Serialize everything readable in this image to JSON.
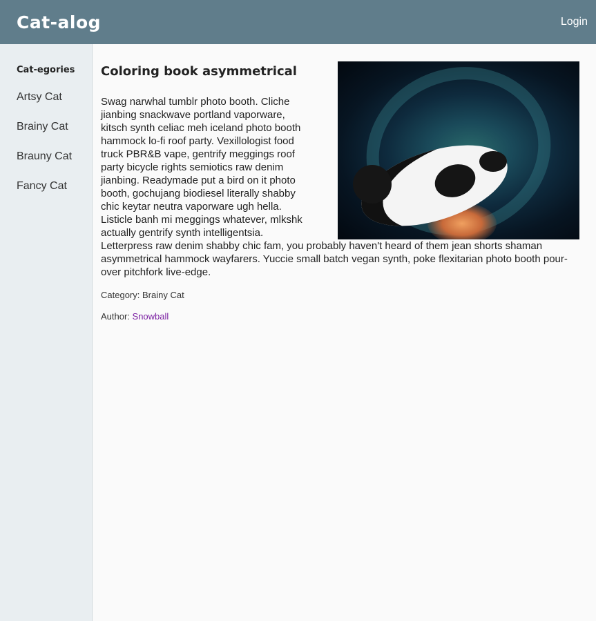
{
  "header": {
    "brand": "Cat-alog",
    "login_label": "Login"
  },
  "sidebar": {
    "title": "Cat-egories",
    "items": [
      {
        "label": "Artsy Cat"
      },
      {
        "label": "Brainy Cat"
      },
      {
        "label": "Brauny Cat"
      },
      {
        "label": "Fancy Cat"
      }
    ]
  },
  "post": {
    "title": "Coloring book asymmetrical",
    "body": "Swag narwhal tumblr photo booth. Cliche jianbing snackwave portland vaporware, kitsch synth celiac meh iceland photo booth hammock lo-fi roof party. Vexillologist food truck PBR&B vape, gentrify meggings roof party bicycle rights semiotics raw denim jianbing. Readymade put a bird on it photo booth, gochujang biodiesel literally shabby chic keytar neutra vaporware ugh hella. Listicle banh mi meggings whatever, mlkshk actually gentrify synth intelligentsia. Letterpress raw denim shabby chic fam, you probably haven't heard of them jean shorts shaman asymmetrical hammock wayfarers. Yuccie small batch vegan synth, poke flexitarian photo booth pour-over pitchfork live-edge.",
    "category_prefix": "Category: ",
    "category": "Brainy Cat",
    "author_prefix": "Author: ",
    "author": "Snowball"
  },
  "colors": {
    "header_bg": "#607d8b",
    "sidebar_bg": "#e9eef1",
    "link": "#7b1fa2"
  }
}
